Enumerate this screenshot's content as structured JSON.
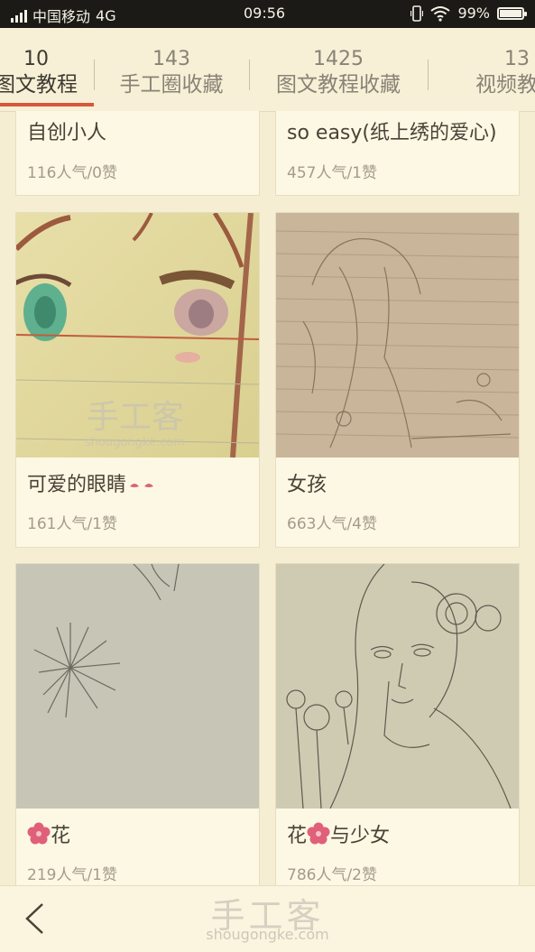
{
  "status_bar": {
    "carrier": "中国移动",
    "network": "4G",
    "time": "09:56",
    "battery": "99%",
    "battery_level": 0.99
  },
  "tabs": [
    {
      "count": "10",
      "label": "图文教程",
      "visible_label": "图文教程",
      "active": true
    },
    {
      "count": "143",
      "label": "手工圈收藏",
      "active": false
    },
    {
      "count": "1425",
      "label": "图文教程收藏",
      "active": false
    },
    {
      "count": "13",
      "label": "视频教程",
      "active": false
    }
  ],
  "cards": [
    {
      "title": "自创小人",
      "stats": "116人气/0赞"
    },
    {
      "title": "so easy(纸上绣的爱心)",
      "stats": "457人气/1赞"
    },
    {
      "title": "可爱的眼睛",
      "stats": "161人气/1赞"
    },
    {
      "title": "女孩",
      "stats": "663人气/4赞"
    },
    {
      "title": "花",
      "stats": "219人气/1赞"
    },
    {
      "title": "花",
      "title_suffix": "与少女",
      "stats": "786人气/2赞"
    }
  ],
  "watermark": {
    "cn": "手工客",
    "en": "shougongke.com"
  },
  "bottom_bar": {
    "logo_cn": "手工客",
    "logo_en": "shougongke.com"
  },
  "colors": {
    "accent": "#d8573a",
    "background": "#f6eed3",
    "card": "#fdf8e4"
  }
}
